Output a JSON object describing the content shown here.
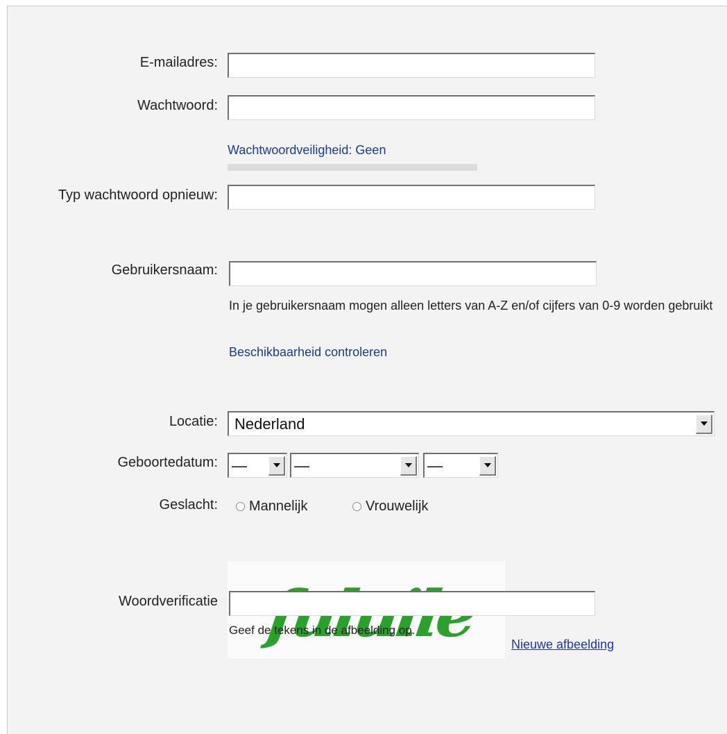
{
  "form": {
    "email": {
      "label": "E-mailadres:",
      "value": ""
    },
    "password": {
      "label": "Wachtwoord:",
      "value": ""
    },
    "password_strength": {
      "text": "Wachtwoordveiligheid: Geen",
      "level": 0
    },
    "password_repeat": {
      "label": "Typ wachtwoord opnieuw:",
      "value": ""
    },
    "username": {
      "label": "Gebruikersnaam:",
      "value": "",
      "help": "In je gebruikersnaam mogen alleen letters van A-Z en/of cijfers van 0-9 worden gebruikt",
      "check_link": "Beschikbaarheid controleren"
    },
    "location": {
      "label": "Locatie:",
      "selected": "Nederland"
    },
    "birthdate": {
      "label": "Geboortedatum:",
      "day": "—",
      "month": "—",
      "year": "—"
    },
    "gender": {
      "label": "Geslacht:",
      "options": [
        "Mannelijk",
        "Vrouwelijk"
      ]
    },
    "captcha": {
      "text": "fuluile",
      "new_image_link": "Nieuwe afbeelding",
      "label": "Woordverificatie",
      "value": "",
      "hint": "Geef de tekens in de afbeelding op."
    }
  },
  "colors": {
    "link": "#1a3a8c",
    "captcha_green": "#2aa12a",
    "panel_bg": "#f3f3f3"
  }
}
